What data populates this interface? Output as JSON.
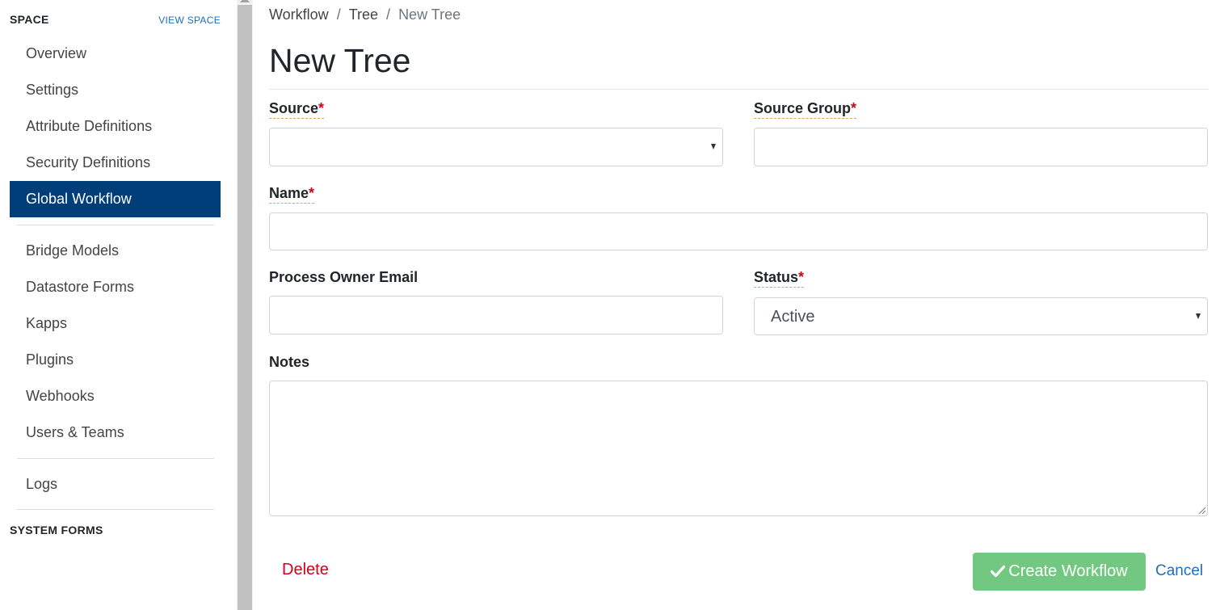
{
  "sidebar": {
    "space_title": "SPACE",
    "view_space_link": "VIEW SPACE",
    "items": [
      {
        "label": "Overview"
      },
      {
        "label": "Settings"
      },
      {
        "label": "Attribute Definitions"
      },
      {
        "label": "Security Definitions"
      },
      {
        "label": "Global Workflow",
        "active": true
      }
    ],
    "items2": [
      {
        "label": "Bridge Models"
      },
      {
        "label": "Datastore Forms"
      },
      {
        "label": "Kapps"
      },
      {
        "label": "Plugins"
      },
      {
        "label": "Webhooks"
      },
      {
        "label": "Users & Teams"
      }
    ],
    "items3": [
      {
        "label": "Logs"
      }
    ],
    "system_forms_title": "SYSTEM FORMS"
  },
  "breadcrumb": {
    "items": [
      "Workflow",
      "Tree",
      "New Tree"
    ],
    "separator": "/"
  },
  "page_title": "New Tree",
  "form": {
    "source": {
      "label": "Source",
      "required_mark": "*",
      "value": ""
    },
    "source_group": {
      "label": "Source Group",
      "required_mark": "*",
      "value": ""
    },
    "name": {
      "label": "Name",
      "required_mark": "*",
      "value": ""
    },
    "process_owner_email": {
      "label": "Process Owner Email",
      "value": ""
    },
    "status": {
      "label": "Status",
      "required_mark": "*",
      "value": "Active"
    },
    "notes": {
      "label": "Notes",
      "value": ""
    }
  },
  "actions": {
    "delete_label": "Delete",
    "create_label": "Create Workflow",
    "cancel_label": "Cancel"
  },
  "colors": {
    "sidebar_active_bg": "#003e7a",
    "link": "#1a6fc0",
    "danger": "#d0021b",
    "create_button_bg": "#72c880"
  },
  "icons": {
    "create_button_icon": "check-icon",
    "select_caret": "caret-down-icon"
  }
}
